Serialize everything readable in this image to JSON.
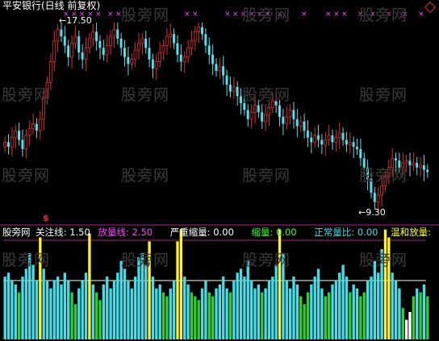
{
  "header": {
    "title": "平安银行(日线 前复权)",
    "high_label": "17.50",
    "low_label": "9.30",
    "signal_marker": "$"
  },
  "watermark": "股旁网",
  "indicator": {
    "name": "股旁网",
    "items": [
      {
        "label": "关注线:",
        "value": "1.50",
        "color": "#ffffff"
      },
      {
        "label": "放量线:",
        "value": "2.50",
        "color": "#ff44ff"
      },
      {
        "label": "严重缩量:",
        "value": "0.00",
        "color": "#ffffff"
      },
      {
        "label": "缩量:",
        "value": "0.00",
        "color": "#33ff33"
      },
      {
        "label": "正常量比:",
        "value": "0.00",
        "color": "#44dddd"
      },
      {
        "label": "温和放量:",
        "value": "",
        "color": "#ffff33"
      }
    ]
  },
  "colors": {
    "up": "#e03030",
    "down": "#55e0ee",
    "marker_x": "#ff44ff",
    "ref_line": "#ffffcc",
    "separator": "#b0208a",
    "vol_cyan": "#44dde8",
    "vol_green": "#33cc33",
    "vol_yellow": "#ffee33",
    "vol_white": "#ffffff"
  },
  "chart_data": [
    {
      "type": "candlestick",
      "title": "平安银行(日线 前复权)",
      "high": 17.5,
      "low": 9.3,
      "closes": [
        12.3,
        12.1,
        12.5,
        12.8,
        12.4,
        12.0,
        12.6,
        12.9,
        13.1,
        12.8,
        13.3,
        14.2,
        14.9,
        15.8,
        16.7,
        17.2,
        16.9,
        16.5,
        16.0,
        16.6,
        16.9,
        16.2,
        15.9,
        16.4,
        16.8,
        17.1,
        16.7,
        16.4,
        16.1,
        16.5,
        16.9,
        17.2,
        16.8,
        16.4,
        16.0,
        15.7,
        15.9,
        16.3,
        16.6,
        16.8,
        16.4,
        15.9,
        15.5,
        15.8,
        16.2,
        16.5,
        16.9,
        17.0,
        16.6,
        16.1,
        15.8,
        16.0,
        16.4,
        16.7,
        17.1,
        17.3,
        17.0,
        16.5,
        16.1,
        15.7,
        15.4,
        15.6,
        15.2,
        14.8,
        14.5,
        14.7,
        14.3,
        14.0,
        13.7,
        13.3,
        13.6,
        13.9,
        13.6,
        13.2,
        13.5,
        13.8,
        14.1,
        13.9,
        13.4,
        13.1,
        13.4,
        13.7,
        13.3,
        13.0,
        13.2,
        12.8,
        12.5,
        12.3,
        12.6,
        12.4,
        12.2,
        12.4,
        12.6,
        12.3,
        12.5,
        12.7,
        12.4,
        12.2,
        12.3,
        12.1,
        12.0,
        11.6,
        11.2,
        10.7,
        10.1,
        9.7,
        10.0,
        10.4,
        10.8,
        11.2,
        11.6,
        11.5,
        11.2,
        11.4,
        11.5,
        11.3,
        11.4,
        11.2,
        11.3,
        11.1,
        11.0
      ],
      "x_markers": [
        {
          "row": 1,
          "count": 7,
          "color": "#ff44ff"
        }
      ]
    },
    {
      "type": "bar",
      "title": "股旁网",
      "reference_lines": {
        "关注线": 1.5,
        "放量线": 2.5
      },
      "values": [
        1.6,
        1.7,
        1.5,
        1.4,
        1.2,
        1.6,
        1.8,
        2.2,
        1.9,
        1.5,
        2.6,
        1.8,
        1.5,
        1.3,
        1.5,
        1.6,
        1.4,
        1.7,
        1.5,
        1.2,
        0.9,
        1.3,
        1.5,
        1.7,
        2.7,
        1.4,
        1.2,
        1.0,
        1.4,
        1.6,
        1.3,
        1.5,
        1.7,
        2.0,
        1.8,
        1.5,
        1.3,
        1.6,
        2.1,
        2.2,
        1.9,
        2.5,
        1.6,
        1.3,
        1.4,
        1.2,
        1.1,
        1.3,
        1.5,
        2.5,
        2.8,
        1.6,
        1.4,
        1.2,
        1.1,
        1.0,
        1.3,
        1.5,
        1.2,
        1.1,
        1.3,
        1.4,
        1.6,
        1.3,
        1.2,
        1.5,
        1.7,
        1.8,
        1.6,
        2.0,
        1.5,
        1.3,
        1.4,
        1.2,
        1.3,
        1.5,
        1.6,
        1.9,
        2.8,
        2.2,
        1.5,
        1.3,
        1.6,
        1.4,
        1.1,
        0.9,
        1.2,
        1.4,
        1.6,
        1.8,
        1.3,
        1.1,
        1.2,
        1.4,
        1.5,
        1.7,
        1.9,
        1.6,
        1.2,
        1.4,
        1.3,
        1.1,
        1.2,
        1.5,
        1.6,
        2.0,
        1.7,
        2.3,
        2.8,
        2.6,
        1.7,
        1.5,
        1.3,
        0.8,
        0.5,
        0.7,
        1.1,
        1.3,
        1.2,
        1.4,
        1.1
      ]
    }
  ]
}
